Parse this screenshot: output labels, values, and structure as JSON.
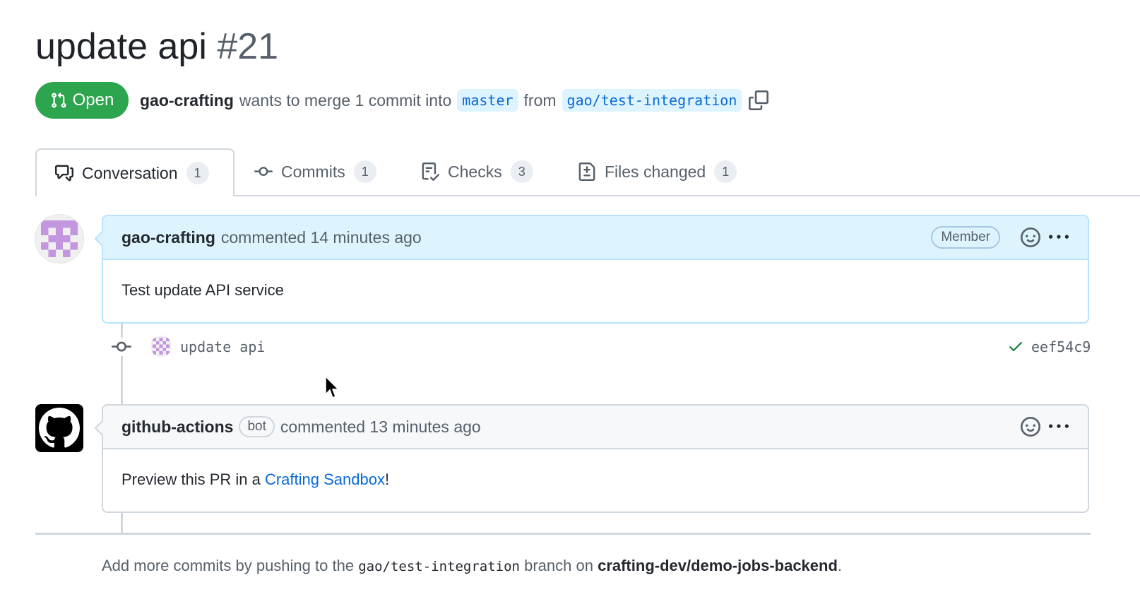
{
  "title": {
    "text": "update api",
    "number": "#21"
  },
  "state": {
    "label": "Open",
    "color": "#2da44e"
  },
  "meta": {
    "author": "gao-crafting",
    "text_1": "wants to merge 1 commit into",
    "base_branch": "master",
    "text_2": "from",
    "head_branch": "gao/test-integration"
  },
  "tabs": [
    {
      "label": "Conversation",
      "count": "1",
      "icon": "comment-discussion-icon"
    },
    {
      "label": "Commits",
      "count": "1",
      "icon": "git-commit-icon"
    },
    {
      "label": "Checks",
      "count": "3",
      "icon": "checklist-icon"
    },
    {
      "label": "Files changed",
      "count": "1",
      "icon": "file-diff-icon"
    }
  ],
  "comments": [
    {
      "author": "gao-crafting",
      "action": "commented 14 minutes ago",
      "badge": "Member",
      "body": "Test update API service"
    },
    {
      "author": "github-actions",
      "badge": "bot",
      "action": "commented 13 minutes ago",
      "body_prefix": "Preview this PR in a ",
      "link": "Crafting Sandbox",
      "body_suffix": "!"
    }
  ],
  "commit": {
    "message": "update api",
    "sha": "eef54c9",
    "status": "success"
  },
  "footer": {
    "text_1": "Add more commits by pushing to the",
    "branch": "gao/test-integration",
    "text_2": "branch on",
    "repo": "crafting-dev/demo-jobs-backend",
    "text_3": "."
  },
  "colors": {
    "accent": "#0969da",
    "open": "#2da44e",
    "highlight": "#ddf4ff"
  }
}
